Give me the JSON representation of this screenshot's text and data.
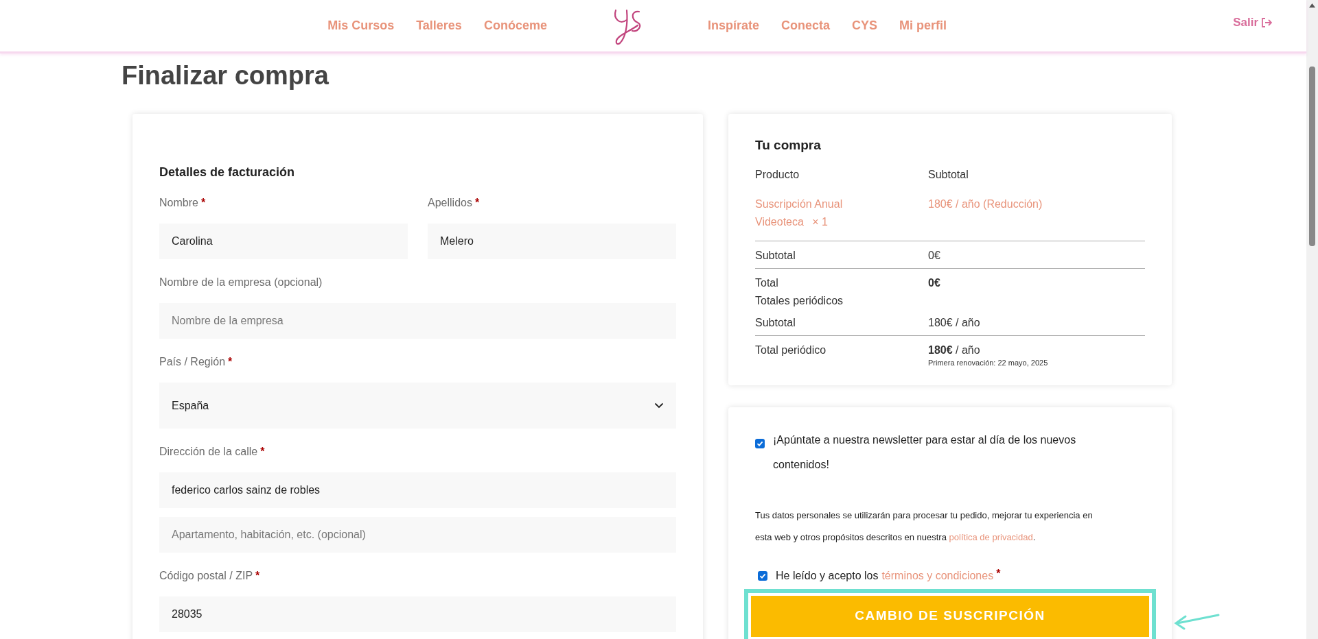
{
  "nav": {
    "left": [
      {
        "label": "Mis Cursos"
      },
      {
        "label": "Talleres"
      },
      {
        "label": "Conóceme"
      }
    ],
    "right": [
      {
        "label": "Inspírate"
      },
      {
        "label": "Conecta"
      },
      {
        "label": "CYS"
      },
      {
        "label": "Mi perfil"
      }
    ],
    "logout": "Salir"
  },
  "page_title": "Finalizar compra",
  "billing": {
    "title": "Detalles de facturación",
    "field_rows": [
      [
        {
          "kind": "text",
          "label": "Nombre",
          "required_mark": "*",
          "value": "Carolina"
        },
        {
          "kind": "text",
          "label": "Apellidos",
          "required_mark": "*",
          "value": "Melero"
        }
      ],
      [
        {
          "kind": "text",
          "label": "Nombre de la empresa (opcional)",
          "placeholder": "Nombre de la empresa"
        }
      ],
      [
        {
          "kind": "select",
          "label": "País / Región",
          "required_mark": "*",
          "value": "España"
        }
      ],
      [
        {
          "kind": "text",
          "label": "Dirección de la calle",
          "required_mark": "*",
          "value": "federico carlos sainz de robles"
        }
      ],
      [
        {
          "kind": "text",
          "placeholder": "Apartamento, habitación, etc. (opcional)"
        }
      ],
      [
        {
          "kind": "text",
          "label": "Código postal / ZIP",
          "required_mark": "*",
          "value": "28035"
        }
      ]
    ]
  },
  "order": {
    "title": "Tu compra",
    "columns": [
      "Producto",
      "Subtotal"
    ],
    "item": {
      "name": "Suscripción Anual Videoteca",
      "quantity": "× 1",
      "price": "180€ / año (Reducción)"
    },
    "rows": [
      {
        "kind": "row",
        "label": "Subtotal",
        "value": "0€",
        "divider": true,
        "bold": false
      },
      {
        "kind": "row",
        "label": "Total",
        "value": "0€",
        "divider": true,
        "bold": true
      },
      {
        "kind": "heading",
        "label": "Totales periódicos",
        "divider": false
      },
      {
        "kind": "row",
        "label": "Subtotal",
        "value": "180€ / año",
        "divider": false,
        "bold": false
      },
      {
        "kind": "row",
        "label": "Total periódico",
        "value": "**180€** / año",
        "note": "Primera renovación: 22 mayo, 2025",
        "divider": true,
        "bold": false
      }
    ]
  },
  "consent": {
    "newsletter": {
      "checked": true,
      "label": "¡Apúntate a nuestra newsletter para estar al día de los nuevos contenidos!"
    },
    "privacy": {
      "before": "Tus datos personales se utilizarán para procesar tu pedido, mejorar tu experiencia en esta web y otros propósitos descritos en nuestra",
      "link": "política de privacidad",
      "after": "."
    },
    "terms": {
      "checked": true,
      "before": "He leído y acepto los",
      "link": "términos y condiciones",
      "required_mark": "*"
    },
    "submit": "CAMBIO DE SUSCRIPCIÓN"
  }
}
